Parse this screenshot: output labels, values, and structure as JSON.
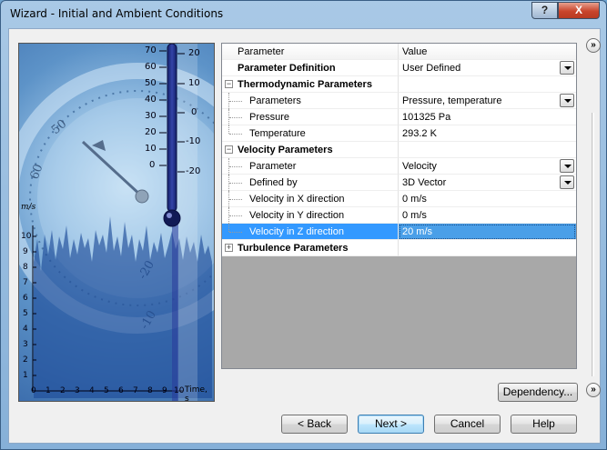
{
  "window": {
    "title": "Wizard - Initial and Ambient Conditions",
    "help_glyph": "?",
    "close_glyph": "X"
  },
  "image": {
    "thermo_ticks_left": [
      "70",
      "60",
      "50",
      "40",
      "30",
      "20",
      "10",
      "0"
    ],
    "thermo_ticks_right": [
      "20",
      "10",
      "0",
      "-10",
      "-20"
    ],
    "y_unit": "m/s",
    "y_ticks": [
      "10",
      "9",
      "8",
      "7",
      "6",
      "5",
      "4",
      "3",
      "2",
      "1"
    ],
    "x_ticks": [
      "0",
      "1",
      "2",
      "3",
      "4",
      "5",
      "6",
      "7",
      "8",
      "9",
      "10"
    ],
    "x_unit": "Time, s"
  },
  "grid": {
    "col_param": "Parameter",
    "col_value": "Value",
    "rows": [
      {
        "label": "Parameter Definition",
        "value": "User Defined",
        "dropdown": true
      },
      {
        "label": "Thermodynamic Parameters",
        "value": ""
      },
      {
        "label": "Parameters",
        "value": "Pressure, temperature",
        "dropdown": true
      },
      {
        "label": "Pressure",
        "value": "101325 Pa"
      },
      {
        "label": "Temperature",
        "value": "293.2 K"
      },
      {
        "label": "Velocity Parameters",
        "value": ""
      },
      {
        "label": "Parameter",
        "value": "Velocity",
        "dropdown": true
      },
      {
        "label": "Defined by",
        "value": "3D Vector",
        "dropdown": true
      },
      {
        "label": "Velocity in X direction",
        "value": "0 m/s"
      },
      {
        "label": "Velocity in Y direction",
        "value": "0 m/s"
      },
      {
        "label": "Velocity in Z direction",
        "value": "20 m/s"
      },
      {
        "label": "Turbulence Parameters",
        "value": ""
      }
    ],
    "expand_minus": "−",
    "expand_plus": "+"
  },
  "side": {
    "collapse_glyph": "»",
    "expand_glyph": "»"
  },
  "buttons": {
    "dependency": "Dependency...",
    "back": "< Back",
    "next": "Next >",
    "cancel": "Cancel",
    "help": "Help"
  }
}
